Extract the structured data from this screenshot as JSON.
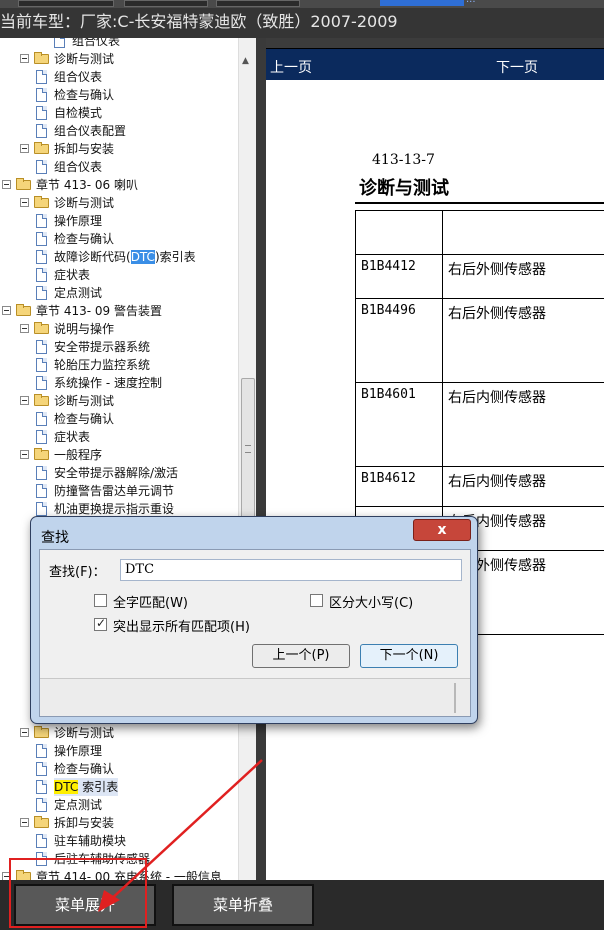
{
  "header": {
    "title": "当前车型：厂家:C-长安福特蒙迪欧（致胜）2007-2009"
  },
  "top": {
    "link_dots": "..."
  },
  "tree": {
    "rows": [
      {
        "level": 3,
        "type": "doc",
        "label": "组合仪表"
      },
      {
        "level": 1,
        "type": "folder",
        "label": "诊断与测试"
      },
      {
        "level": 2,
        "type": "doc",
        "label": "组合仪表"
      },
      {
        "level": 2,
        "type": "doc",
        "label": "检查与确认"
      },
      {
        "level": 2,
        "type": "doc",
        "label": "自检模式"
      },
      {
        "level": 2,
        "type": "doc",
        "label": "组合仪表配置"
      },
      {
        "level": 1,
        "type": "folder",
        "label": "拆卸与安装"
      },
      {
        "level": 2,
        "type": "doc",
        "label": "组合仪表"
      },
      {
        "level": 0,
        "type": "folder",
        "label": "章节 413- 06 喇叭"
      },
      {
        "level": 1,
        "type": "folder",
        "label": "诊断与测试"
      },
      {
        "level": 2,
        "type": "doc",
        "label": "操作原理"
      },
      {
        "level": 2,
        "type": "doc",
        "label": "检查与确认"
      },
      {
        "level": 2,
        "type": "doc",
        "label": "故障诊断代码(DTC)索引表",
        "hl": "blue"
      },
      {
        "level": 2,
        "type": "doc",
        "label": "症状表"
      },
      {
        "level": 2,
        "type": "doc",
        "label": "定点测试"
      },
      {
        "level": 0,
        "type": "folder",
        "label": "章节 413- 09 警告装置"
      },
      {
        "level": 1,
        "type": "folder",
        "label": "说明与操作"
      },
      {
        "level": 2,
        "type": "doc",
        "label": "安全带提示器系统"
      },
      {
        "level": 2,
        "type": "doc",
        "label": "轮胎压力监控系统"
      },
      {
        "level": 2,
        "type": "doc",
        "label": "系统操作 - 速度控制"
      },
      {
        "level": 1,
        "type": "folder",
        "label": "诊断与测试"
      },
      {
        "level": 2,
        "type": "doc",
        "label": "检查与确认"
      },
      {
        "level": 2,
        "type": "doc",
        "label": "症状表"
      },
      {
        "level": 1,
        "type": "folder",
        "label": "一般程序"
      },
      {
        "level": 2,
        "type": "doc",
        "label": "安全带提示器解除/激活"
      },
      {
        "level": 2,
        "type": "doc",
        "label": "防撞警告雷达单元调节"
      },
      {
        "level": 2,
        "type": "doc",
        "label": "机油更换提示指示重设"
      }
    ],
    "rows_bottom": [
      {
        "level": 1,
        "type": "folder",
        "label": "诊断与测试"
      },
      {
        "level": 2,
        "type": "doc",
        "label": "操作原理"
      },
      {
        "level": 2,
        "type": "doc",
        "label": "检查与确认"
      },
      {
        "level": 2,
        "type": "doc",
        "label": "DTC 索引表",
        "hl": "yellow"
      },
      {
        "level": 2,
        "type": "doc",
        "label": "定点测试"
      },
      {
        "level": 1,
        "type": "folder",
        "label": "拆卸与安装"
      },
      {
        "level": 2,
        "type": "doc",
        "label": "驻车辅助模块"
      },
      {
        "level": 2,
        "type": "doc",
        "label": "后驻车辅助传感器"
      },
      {
        "level": 0,
        "type": "folder",
        "label": "章节 414- 00 充电系统 - 一般信息"
      }
    ]
  },
  "doc": {
    "prev": "上一页",
    "next": "下一页",
    "section_number": "413-13-7",
    "section_title": "诊断与测试",
    "table": [
      {
        "code": "",
        "desc": ""
      },
      {
        "code": "B1B4412",
        "desc": "右后外侧传感器"
      },
      {
        "code": "B1B4496",
        "desc": "右后外侧传感器"
      },
      {
        "code": "B1B4601",
        "desc": "右后内侧传感器"
      },
      {
        "code": "B1B4612",
        "desc": "右后内侧传感器"
      },
      {
        "code": "",
        "desc": "右后内侧传感器"
      },
      {
        "code": "",
        "desc": "右后外侧传感器"
      }
    ]
  },
  "dialog": {
    "title": "查找",
    "close": "x",
    "find_label": "查找(F)：",
    "find_value": "DTC",
    "whole_word": {
      "label": "全字匹配(W)",
      "checked": false
    },
    "match_case": {
      "label": "区分大小写(C)",
      "checked": false
    },
    "highlight_all": {
      "label": "突出显示所有匹配项(H)",
      "checked": true
    },
    "prev_button": "上一个(P)",
    "next_button": "下一个(N)"
  },
  "bottom": {
    "expand": "菜单展开",
    "collapse": "菜单折叠"
  },
  "colors": {
    "annotation": "#e02020",
    "nav": "#0b2a5d",
    "search_hit": "#ffef00",
    "selection": "#3a8ee6"
  }
}
